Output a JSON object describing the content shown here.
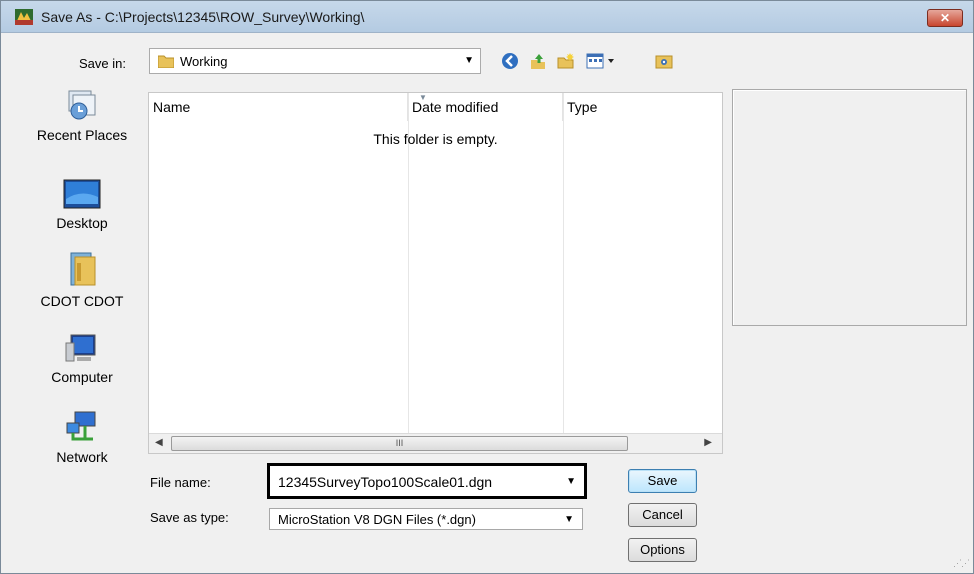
{
  "window": {
    "title": "Save As - C:\\Projects\\12345\\ROW_Survey\\Working\\",
    "close_symbol": "✕"
  },
  "toolbar": {
    "save_in_label": "Save in:",
    "save_in_value": "Working",
    "back_icon": "back-icon",
    "up_icon": "up-folder-icon",
    "new_folder_icon": "new-folder-icon",
    "views_icon": "views-menu-icon",
    "config_icon": "project-folder-icon"
  },
  "places": [
    {
      "label": "Recent Places",
      "icon": "recent-places-icon"
    },
    {
      "label": "Desktop",
      "icon": "desktop-icon"
    },
    {
      "label": "CDOT CDOT",
      "icon": "user-folder-icon"
    },
    {
      "label": "Computer",
      "icon": "computer-icon"
    },
    {
      "label": "Network",
      "icon": "network-icon"
    }
  ],
  "file_list": {
    "columns": [
      "Name",
      "Date modified",
      "Type"
    ],
    "empty_message": "This folder is empty.",
    "scroll_thumb_mark": "III"
  },
  "form": {
    "file_name_label": "File name:",
    "file_name_value": "12345SurveyTopo100Scale01.dgn",
    "save_as_type_label": "Save as type:",
    "save_as_type_value": "MicroStation V8 DGN Files (*.dgn)"
  },
  "buttons": {
    "save": "Save",
    "cancel": "Cancel",
    "options": "Options"
  },
  "colors": {
    "titlebar": "#b9cfe5",
    "close_button": "#c8462f",
    "highlight_border": "#000000"
  }
}
